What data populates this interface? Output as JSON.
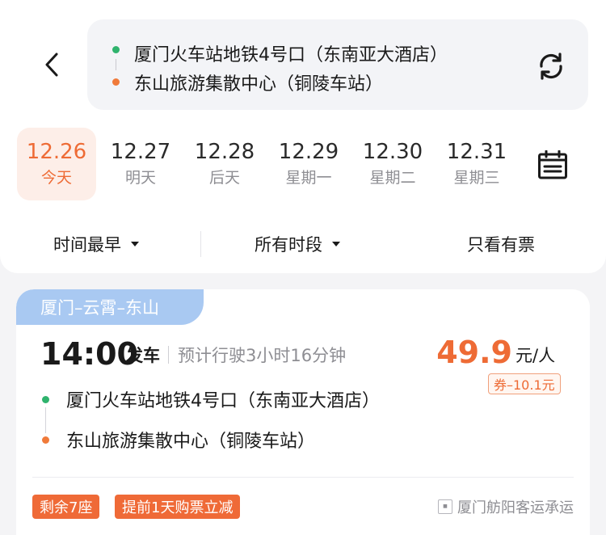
{
  "header": {
    "from_station": "厦门火车站地铁4号口（东南亚大酒店）",
    "to_station": "东山旅游集散中心（铜陵车站）"
  },
  "dates": [
    {
      "date": "12.26",
      "label": "今天",
      "active": true
    },
    {
      "date": "12.27",
      "label": "明天",
      "active": false
    },
    {
      "date": "12.28",
      "label": "后天",
      "active": false
    },
    {
      "date": "12.29",
      "label": "星期一",
      "active": false
    },
    {
      "date": "12.30",
      "label": "星期二",
      "active": false
    },
    {
      "date": "12.31",
      "label": "星期三",
      "active": false
    }
  ],
  "filters": {
    "sort": "时间最早",
    "period": "所有时段",
    "available_only": "只看有票"
  },
  "trip": {
    "route_tag": "厦门–云霄–东山",
    "depart_time": "14:00",
    "depart_label": "发车",
    "duration": "预计行驶3小时16分钟",
    "price": "49.9",
    "price_unit": "元/人",
    "coupon": "券–10.1元",
    "from_stop": "厦门火车站地铁4号口（东南亚大酒店）",
    "to_stop": "东山旅游集散中心（铜陵车站）",
    "seats_left": "剩余7座",
    "promo": "提前1天购票立减",
    "carrier": "厦门舫阳客运承运"
  },
  "colors": {
    "accent": "#ee6b35",
    "route_tag_bg": "#a9c9f2",
    "from_dot": "#2fb36d",
    "to_dot": "#f07a3a"
  },
  "icons": [
    "back-arrow-icon",
    "refresh-icon",
    "calendar-icon",
    "caret-down-icon",
    "carrier-logo-icon"
  ]
}
